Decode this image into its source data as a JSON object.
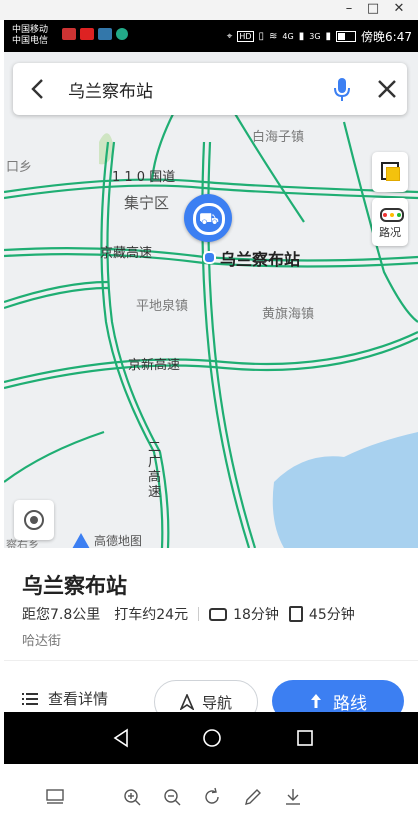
{
  "window_controls": {
    "minimize": "–",
    "maximize": "□",
    "close": "✕"
  },
  "status_bar": {
    "carrier1": "中国移动",
    "carrier2": "中国电信",
    "network": "4G",
    "network2": "3G",
    "time": "傍晚6:47"
  },
  "search": {
    "query": "乌兰察布站"
  },
  "map": {
    "labels": {
      "road_110": "1 1 0 国道",
      "jining": "集宁区",
      "jingzang": "京藏高速",
      "station": "乌兰察布站",
      "pingdiquan": "平地泉镇",
      "huangqihai": "黄旗海镇",
      "jingxin": "京新高速",
      "erguang": "二广高速",
      "baihaizi": "白海子镇",
      "xiang": "口乡",
      "bottom_left": "察右乡"
    },
    "traffic_label": "路况",
    "brand": "高德地图"
  },
  "poi": {
    "title": "乌兰察布站",
    "distance": "距您7.8公里",
    "taxi": "打车约24元",
    "drive_time": "18分钟",
    "bus_time": "45分钟",
    "address": "哈达街"
  },
  "actions": {
    "details": "查看详情",
    "navigate": "导航",
    "route": "路线"
  },
  "colors": {
    "accent": "#3c7ff2",
    "road": "#1fae73",
    "water": "#a8d1ef"
  }
}
